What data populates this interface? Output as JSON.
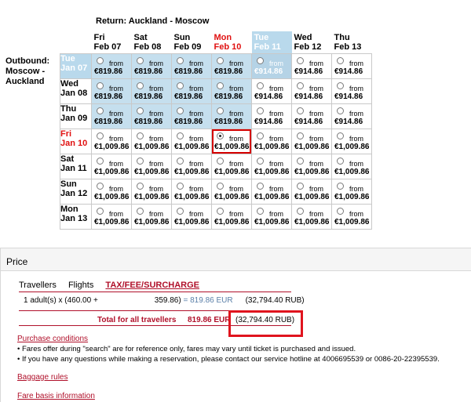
{
  "return_title": "Return: Auckland - Moscow",
  "outbound_title": "Outbound: Moscow - Auckland",
  "columns": [
    {
      "day": "Fri",
      "date": "Feb 07"
    },
    {
      "day": "Sat",
      "date": "Feb 08"
    },
    {
      "day": "Sun",
      "date": "Feb 09"
    },
    {
      "day": "Mon",
      "date": "Feb 10"
    },
    {
      "day": "Tue",
      "date": "Feb 11"
    },
    {
      "day": "Wed",
      "date": "Feb 12"
    },
    {
      "day": "Thu",
      "date": "Feb 13"
    }
  ],
  "rows": [
    {
      "day": "Tue",
      "date": "Jan 07",
      "prices": [
        "€819.86",
        "€819.86",
        "€819.86",
        "€819.86",
        "€914.86",
        "€914.86",
        "€914.86"
      ]
    },
    {
      "day": "Wed",
      "date": "Jan 08",
      "prices": [
        "€819.86",
        "€819.86",
        "€819.86",
        "€819.86",
        "€914.86",
        "€914.86",
        "€914.86"
      ]
    },
    {
      "day": "Thu",
      "date": "Jan 09",
      "prices": [
        "€819.86",
        "€819.86",
        "€819.86",
        "€819.86",
        "€914.86",
        "€914.86",
        "€914.86"
      ]
    },
    {
      "day": "Fri",
      "date": "Jan 10",
      "prices": [
        "€1,009.86",
        "€1,009.86",
        "€1,009.86",
        "€1,009.86",
        "€1,009.86",
        "€1,009.86",
        "€1,009.86"
      ]
    },
    {
      "day": "Sat",
      "date": "Jan 11",
      "prices": [
        "€1,009.86",
        "€1,009.86",
        "€1,009.86",
        "€1,009.86",
        "€1,009.86",
        "€1,009.86",
        "€1,009.86"
      ]
    },
    {
      "day": "Sun",
      "date": "Jan 12",
      "prices": [
        "€1,009.86",
        "€1,009.86",
        "€1,009.86",
        "€1,009.86",
        "€1,009.86",
        "€1,009.86",
        "€1,009.86"
      ]
    },
    {
      "day": "Mon",
      "date": "Jan 13",
      "prices": [
        "€1,009.86",
        "€1,009.86",
        "€1,009.86",
        "€1,009.86",
        "€1,009.86",
        "€1,009.86",
        "€1,009.86"
      ]
    }
  ],
  "from_label": "from",
  "selected": {
    "row": 3,
    "col": 3
  },
  "price_section": {
    "title": "Price",
    "tabs": [
      "Travellers",
      "Flights",
      "TAX/FEE/SURCHARGE"
    ],
    "adult_line": {
      "label": "1 adult(s)",
      "base": "x (460.00 +",
      "tax": "359.86)",
      "equals": "= 819.86 EUR",
      "rub": "(32,794.40 RUB)"
    },
    "total_label": "Total for all travellers",
    "total_eur": "819.86 EUR",
    "total_rub": "(32,794.40 RUB)"
  },
  "purchase_conditions": "Purchase conditions",
  "note1": "• Fares offer during \"search\" are for reference only, fares may vary until ticket is purchased and issued.",
  "note2": "• If you have any questions while making a reservation, please contact our service hotline at 4006695539 or 0086-20-22395539.",
  "baggage_rules": "Baggage rules",
  "fare_basis": "Fare basis information",
  "colors": {
    "accent_red": "#b0102a",
    "highlight_blue": "#b9d9ec",
    "selection_box": "#e0141e"
  }
}
